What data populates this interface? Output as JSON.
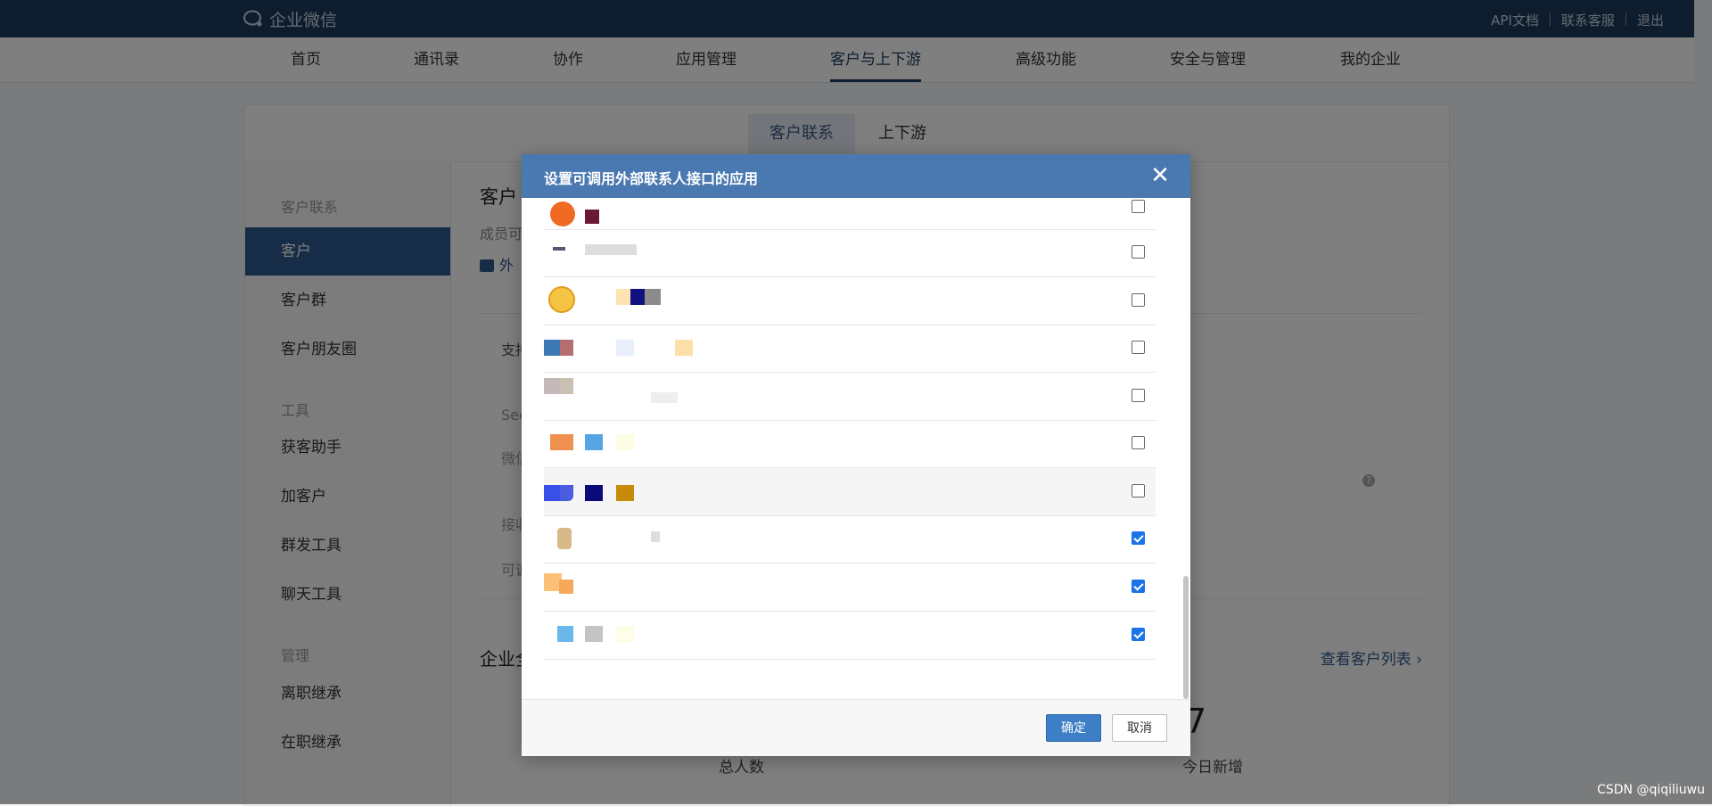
{
  "topbar": {
    "logo_text": "企业微信",
    "links": [
      "API文档",
      "联系客服",
      "退出"
    ],
    "separator": "|"
  },
  "mainnav": {
    "items": [
      "首页",
      "通讯录",
      "协作",
      "应用管理",
      "客户与上下游",
      "高级功能",
      "安全与管理",
      "我的企业"
    ],
    "active_index": 4
  },
  "subtabs": {
    "items": [
      "客户联系",
      "上下游"
    ],
    "active_index": 0
  },
  "sidebar": {
    "group_customer": "客户联系",
    "items_customer": [
      "客户",
      "客户群",
      "客户朋友圈"
    ],
    "group_tools": "工具",
    "items_tools": [
      "获客助手",
      "加客户",
      "群发工具",
      "聊天工具"
    ],
    "group_manage": "管理",
    "items_manage": [
      "离职继承",
      "在职继承"
    ],
    "active_item": "客户"
  },
  "content": {
    "title": "客户",
    "desc": "成员可",
    "link": "外",
    "label_support": "支持",
    "label_sec": "Sec",
    "label_wx": "微信",
    "label_recv": "接收",
    "label_can": "可调",
    "section_title": "企业全",
    "view_list": "查看客户列表 ›",
    "stat_total_value": "",
    "stat_total_label": "总人数",
    "stat_today_value": "7",
    "stat_today_label": "今日新增"
  },
  "modal": {
    "title": "设置可调用外部联系人接口的应用",
    "close_glyph": "✕",
    "rows": [
      {
        "checked": false
      },
      {
        "checked": false
      },
      {
        "checked": false
      },
      {
        "checked": false
      },
      {
        "checked": false
      },
      {
        "checked": false
      },
      {
        "checked": false
      },
      {
        "checked": true
      },
      {
        "checked": true
      },
      {
        "checked": true
      }
    ],
    "ok_label": "确定",
    "cancel_label": "取消"
  },
  "watermark": "CSDN @qiqiliuwu",
  "colors": {
    "topbar": "#1d3a5c",
    "accent": "#2e5a8e",
    "modal_header": "#4a78b0",
    "checkbox_on": "#1a73e8",
    "ok_button": "#3d7fc6"
  }
}
